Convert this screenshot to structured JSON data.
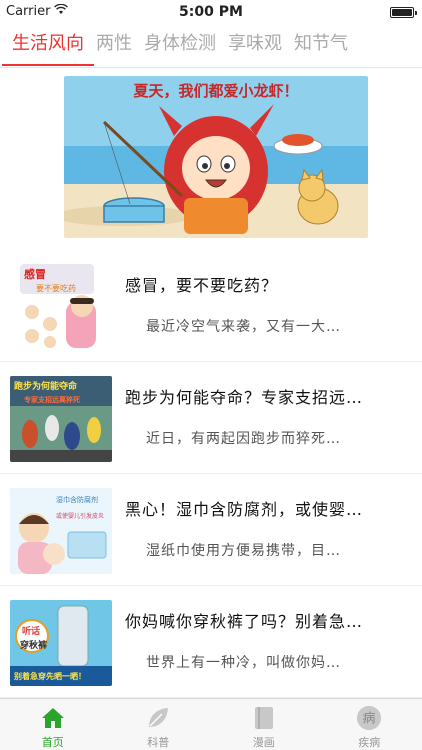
{
  "status_bar": {
    "carrier": "Carrier",
    "time": "5:00 PM"
  },
  "tabs": [
    {
      "label": "生活风向",
      "active": true
    },
    {
      "label": "两性",
      "active": false
    },
    {
      "label": "身体检测",
      "active": false
    },
    {
      "label": "享味观",
      "active": false
    },
    {
      "label": "知节气",
      "active": false
    }
  ],
  "banner": {
    "caption": "夏天，我们都爱小龙虾！"
  },
  "articles": [
    {
      "title": "感冒，要不要吃药？",
      "summary": "最近冷空气来袭，又有一大…",
      "thumb_text": [
        "感冒",
        "要不要吃药"
      ]
    },
    {
      "title": "跑步为何能夺命？专家支招远…",
      "summary": "近日，有两起因跑步而猝死…",
      "thumb_text": [
        "跑步为何能夺命",
        "专家支招远离猝死"
      ]
    },
    {
      "title": "黑心！湿巾含防腐剂，或使婴…",
      "summary": "湿纸巾使用方便易携带，目…",
      "thumb_text": [
        "湿巾含防腐剂",
        "或使婴儿引发皮炎"
      ]
    },
    {
      "title": "你妈喊你穿秋裤了吗？别着急…",
      "summary": "世界上有一种冷，叫做你妈…",
      "thumb_text": [
        "听话",
        "穿秋裤",
        "别着急穿先晒一晒！"
      ]
    }
  ],
  "bottom_nav": [
    {
      "label": "首页",
      "icon": "home-icon",
      "active": true
    },
    {
      "label": "科普",
      "icon": "leaf-icon",
      "active": false
    },
    {
      "label": "漫画",
      "icon": "book-icon",
      "active": false
    },
    {
      "label": "疾病",
      "icon": "disease-icon",
      "active": false,
      "glyph": "病"
    }
  ],
  "colors": {
    "accent": "#e33333",
    "nav_active": "#2aa52a"
  }
}
